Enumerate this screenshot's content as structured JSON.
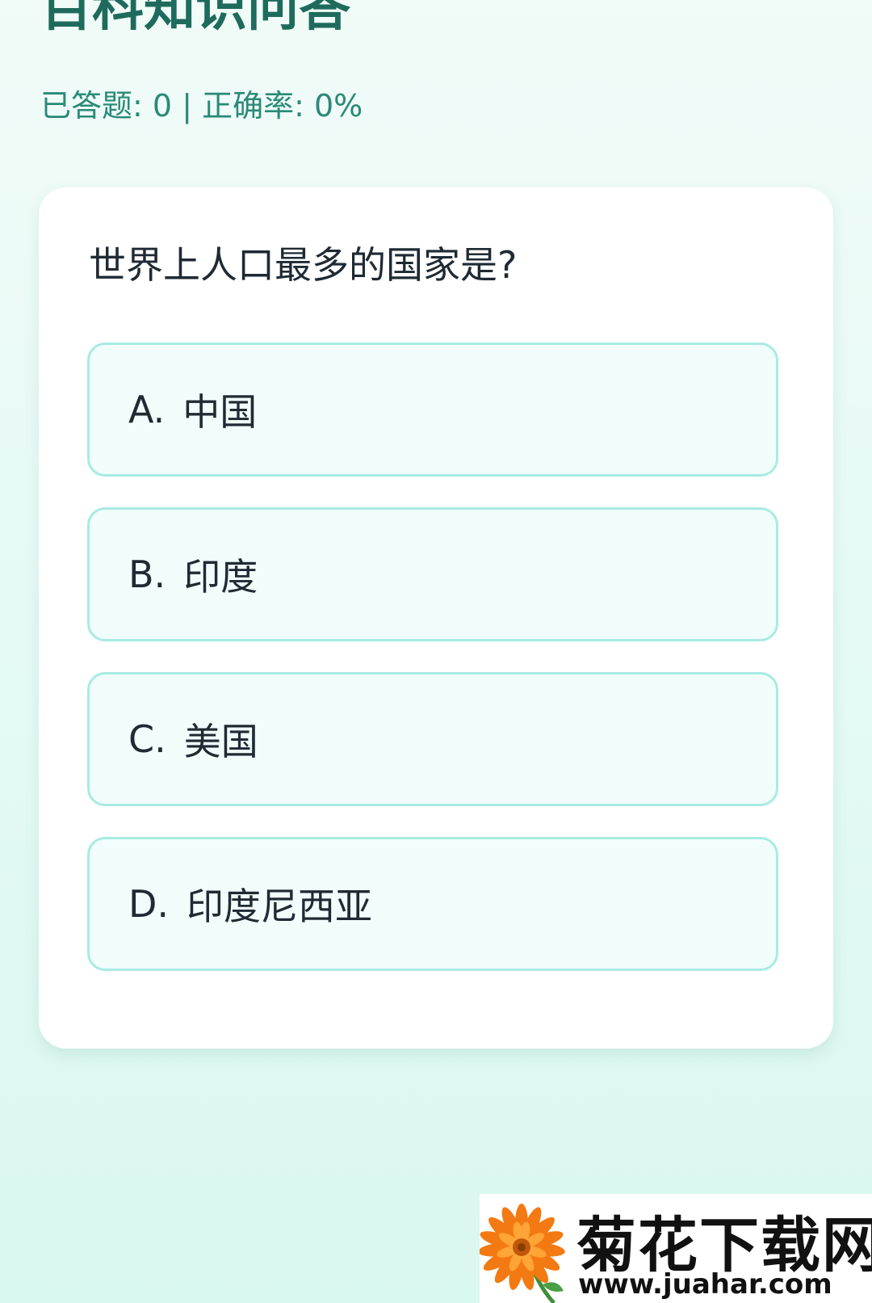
{
  "header": {
    "title": "百科知识问答",
    "stats": {
      "answered_label": "已答题:",
      "answered_value": "0",
      "separator": "|",
      "accuracy_label": "正确率:",
      "accuracy_value": "0%"
    }
  },
  "quiz": {
    "question": "世界上人口最多的国家是?",
    "options": [
      {
        "letter": "A.",
        "text": "中国"
      },
      {
        "letter": "B.",
        "text": "印度"
      },
      {
        "letter": "C.",
        "text": "美国"
      },
      {
        "letter": "D.",
        "text": "印度尼西亚"
      }
    ]
  },
  "watermark": {
    "name": "菊花下载网",
    "url": "www.juahar.com",
    "icon": "chrysanthemum-flower-icon"
  },
  "colors": {
    "title": "#1e6b5c",
    "stats": "#2a8a77",
    "option_border": "#a8ebe3",
    "option_background": "#f0fdfb",
    "card_background": "#ffffff",
    "page_background": "#e6faf5"
  }
}
